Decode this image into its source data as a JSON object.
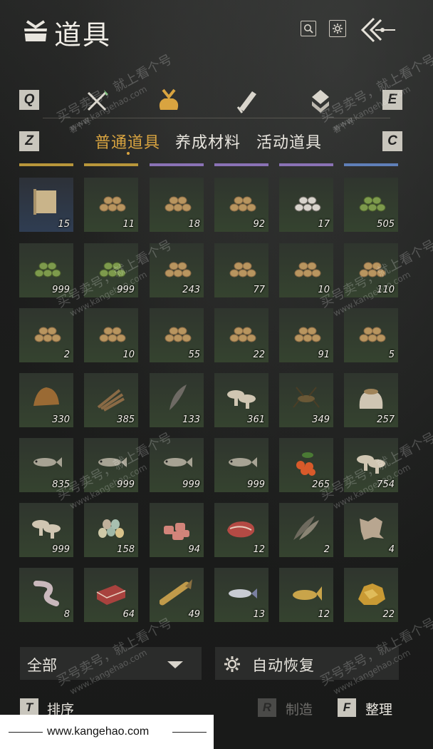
{
  "header": {
    "title": "道具",
    "title_icon": "bag-icon",
    "search_icon": "search-icon",
    "settings_icon": "gear-icon",
    "back_icon": "back-arrow-icon"
  },
  "category_bar": {
    "left_key": "Q",
    "right_key": "E",
    "categories": [
      {
        "icon": "crossed-weapons-icon",
        "active": false
      },
      {
        "icon": "pouch-icon",
        "active": true
      },
      {
        "icon": "scroll-icon",
        "active": false
      },
      {
        "icon": "gem-icon",
        "active": false
      }
    ],
    "accent_color": "#d9a440"
  },
  "tabs": {
    "left_key": "Z",
    "right_key": "C",
    "items": [
      {
        "label": "普通道具",
        "active": true
      },
      {
        "label": "养成材料",
        "active": false
      },
      {
        "label": "活动道具",
        "active": false
      }
    ]
  },
  "rarity_colors": [
    "#b8963a",
    "#b8963a",
    "#8a72b5",
    "#8a72b5",
    "#8a72b5",
    "#5f7fb8"
  ],
  "items": [
    {
      "icon": "map-scroll-icon",
      "count": "15",
      "style": "blue"
    },
    {
      "icon": "logs-icon",
      "count": "11"
    },
    {
      "icon": "logs-icon",
      "count": "18"
    },
    {
      "icon": "logs-icon",
      "count": "92"
    },
    {
      "icon": "birch-logs-icon",
      "count": "17"
    },
    {
      "icon": "bamboo-logs-icon",
      "count": "505"
    },
    {
      "icon": "bamboo-logs-icon",
      "count": "999"
    },
    {
      "icon": "bamboo-logs-icon",
      "count": "999"
    },
    {
      "icon": "logs-icon",
      "count": "243"
    },
    {
      "icon": "logs-icon",
      "count": "77"
    },
    {
      "icon": "logs-icon",
      "count": "10"
    },
    {
      "icon": "logs-icon",
      "count": "110"
    },
    {
      "icon": "logs-icon",
      "count": "2"
    },
    {
      "icon": "logs-icon",
      "count": "10"
    },
    {
      "icon": "logs-icon",
      "count": "55"
    },
    {
      "icon": "logs-icon",
      "count": "22"
    },
    {
      "icon": "logs-icon",
      "count": "91"
    },
    {
      "icon": "logs-icon",
      "count": "5"
    },
    {
      "icon": "fiber-bundle-icon",
      "count": "330"
    },
    {
      "icon": "branches-icon",
      "count": "385"
    },
    {
      "icon": "feather-icon",
      "count": "133"
    },
    {
      "icon": "mushrooms-icon",
      "count": "361"
    },
    {
      "icon": "cricket-icon",
      "count": "349"
    },
    {
      "icon": "grain-sack-icon",
      "count": "257"
    },
    {
      "icon": "fish-icon",
      "count": "835"
    },
    {
      "icon": "fish-icon",
      "count": "999"
    },
    {
      "icon": "fish-icon",
      "count": "999"
    },
    {
      "icon": "fish-icon",
      "count": "999"
    },
    {
      "icon": "berries-icon",
      "count": "265"
    },
    {
      "icon": "mushrooms-icon",
      "count": "754"
    },
    {
      "icon": "mushrooms-icon",
      "count": "999"
    },
    {
      "icon": "eggs-icon",
      "count": "158"
    },
    {
      "icon": "meat-chunks-icon",
      "count": "94"
    },
    {
      "icon": "steak-icon",
      "count": "12"
    },
    {
      "icon": "feathers-icon",
      "count": "2"
    },
    {
      "icon": "fur-pelt-icon",
      "count": "4"
    },
    {
      "icon": "intestine-icon",
      "count": "8"
    },
    {
      "icon": "beef-slab-icon",
      "count": "64"
    },
    {
      "icon": "pike-fish-icon",
      "count": "49"
    },
    {
      "icon": "salmon-icon",
      "count": "13"
    },
    {
      "icon": "carp-icon",
      "count": "12"
    },
    {
      "icon": "gold-ore-icon",
      "count": "22"
    }
  ],
  "filter": {
    "label": "全部",
    "arrow_icon": "chevron-down-icon"
  },
  "auto_restore": {
    "label": "自动恢复",
    "icon": "gear-icon"
  },
  "footer_actions": [
    {
      "key": "T",
      "label": "排序",
      "enabled": true
    },
    {
      "key": "R",
      "label": "制造",
      "enabled": false
    },
    {
      "key": "F",
      "label": "整理",
      "enabled": true
    }
  ],
  "watermark": {
    "line1": "买号卖号，就上看个号",
    "line2": "www.kangehao.com",
    "badge": "看个号"
  },
  "footer_bar": {
    "text": "www.kangehao.com"
  }
}
